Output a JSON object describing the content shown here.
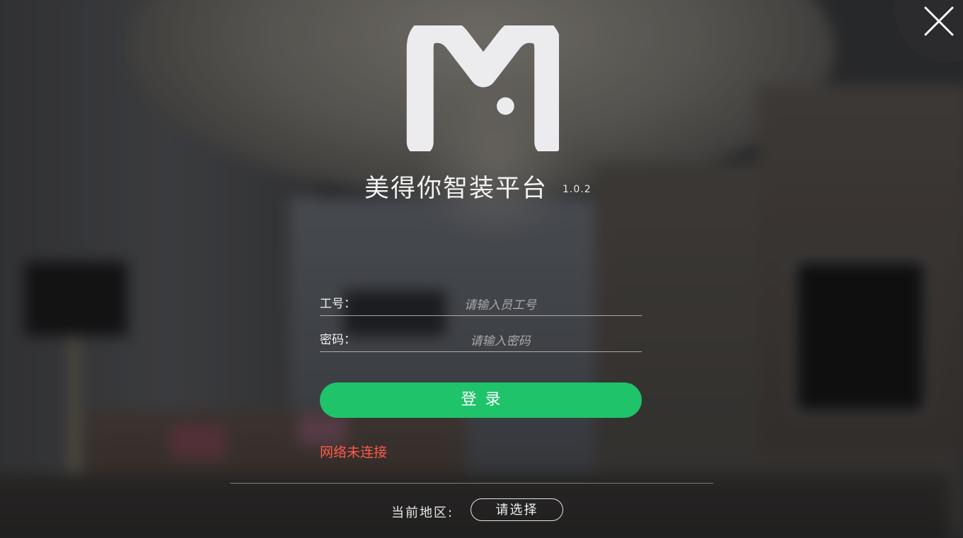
{
  "app": {
    "title": "美得你智装平台",
    "version": "1.0.2"
  },
  "form": {
    "user_label": "工号：",
    "user_placeholder": "请输入员工号",
    "user_value": "",
    "pass_label": "密码：",
    "pass_placeholder": "请输入密码",
    "pass_value": ""
  },
  "login_button": "登录",
  "status": {
    "network": "网络未连接",
    "network_color": "#ff5a4a"
  },
  "region": {
    "label": "当前地区:",
    "select_value": "请选择"
  },
  "colors": {
    "accent": "#1fc36a"
  },
  "icons": {
    "logo": "m-logo",
    "close": "close-icon"
  }
}
